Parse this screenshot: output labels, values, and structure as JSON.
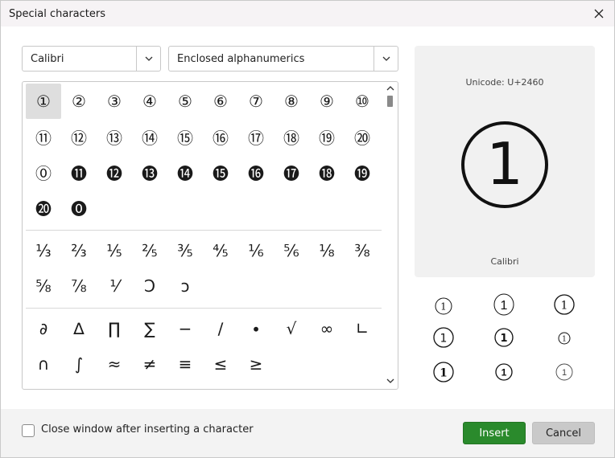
{
  "window": {
    "title": "Special characters"
  },
  "font_select": {
    "value": "Calibri"
  },
  "block_select": {
    "value": "Enclosed alphanumerics"
  },
  "grid": {
    "enclosed": [
      "①",
      "②",
      "③",
      "④",
      "⑤",
      "⑥",
      "⑦",
      "⑧",
      "⑨",
      "⑩",
      "⑪",
      "⑫",
      "⑬",
      "⑭",
      "⑮",
      "⑯",
      "⑰",
      "⑱",
      "⑲",
      "⑳",
      "⓪",
      "⓫",
      "⓬",
      "⓭",
      "⓮",
      "⓯",
      "⓰",
      "⓱",
      "⓲",
      "⓳",
      "⓴",
      "⓿"
    ],
    "fractions": [
      "⅓",
      "⅔",
      "⅕",
      "⅖",
      "⅗",
      "⅘",
      "⅙",
      "⅚",
      "⅛",
      "⅜",
      "⅝",
      "⅞",
      "⅟",
      "Ↄ",
      "ↄ"
    ],
    "math": [
      "∂",
      "∆",
      "∏",
      "∑",
      "−",
      "∕",
      "∙",
      "√",
      "∞",
      "∟",
      "∩",
      "∫",
      "≈",
      "≠",
      "≡",
      "≤",
      "≥"
    ]
  },
  "preview": {
    "unicode": "Unicode: U+2460",
    "font_name": "Calibri",
    "digit": "1"
  },
  "footer": {
    "close_after_insert": "Close window after inserting a character",
    "insert_label": "Insert",
    "cancel_label": "Cancel"
  }
}
